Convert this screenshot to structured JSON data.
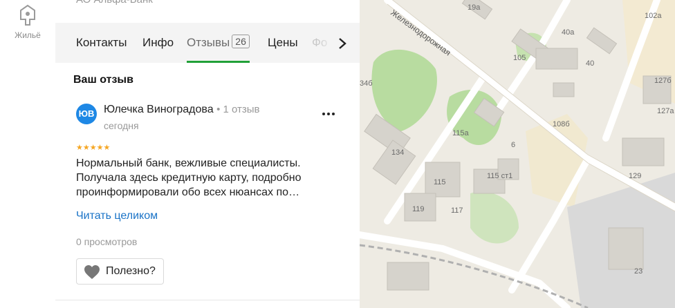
{
  "rail": {
    "housing_label": "Жильё",
    "housing_icon": "house-pin-icon"
  },
  "org": {
    "title": "АО Альфа-Банк"
  },
  "tabs": [
    {
      "label": "Контакты"
    },
    {
      "label": "Инфо"
    },
    {
      "label": "Отзывы",
      "count": "26",
      "active": true
    },
    {
      "label": "Цены"
    },
    {
      "label": "Фо"
    }
  ],
  "review_section": {
    "title": "Ваш отзыв"
  },
  "review": {
    "avatar_initials": "ЮВ",
    "author": "Юлечка Виноградова",
    "author_reviews": "1 отзыв",
    "date": "сегодня",
    "stars": "★★★★★",
    "rating": 5,
    "text": "Нормальный банк, вежливые специалисты. Получала здесь кредитную карту, подробно проинформировали обо всех нюансах по…",
    "read_more": "Читать целиком",
    "views": "0 просмотров",
    "useful_label": "Полезно?"
  },
  "map": {
    "street": "Железнодорожная",
    "house_numbers": [
      "19а",
      "102а",
      "40а",
      "105",
      "40",
      "127б",
      "34б",
      "115а",
      "108б",
      "127а",
      "6",
      "134",
      "115",
      "115 ст1",
      "129",
      "119",
      "117",
      "23"
    ]
  },
  "colors": {
    "accent_green": "#21a038",
    "link_blue": "#1a73c7",
    "star": "#f5a623",
    "avatar": "#1e88e5"
  }
}
